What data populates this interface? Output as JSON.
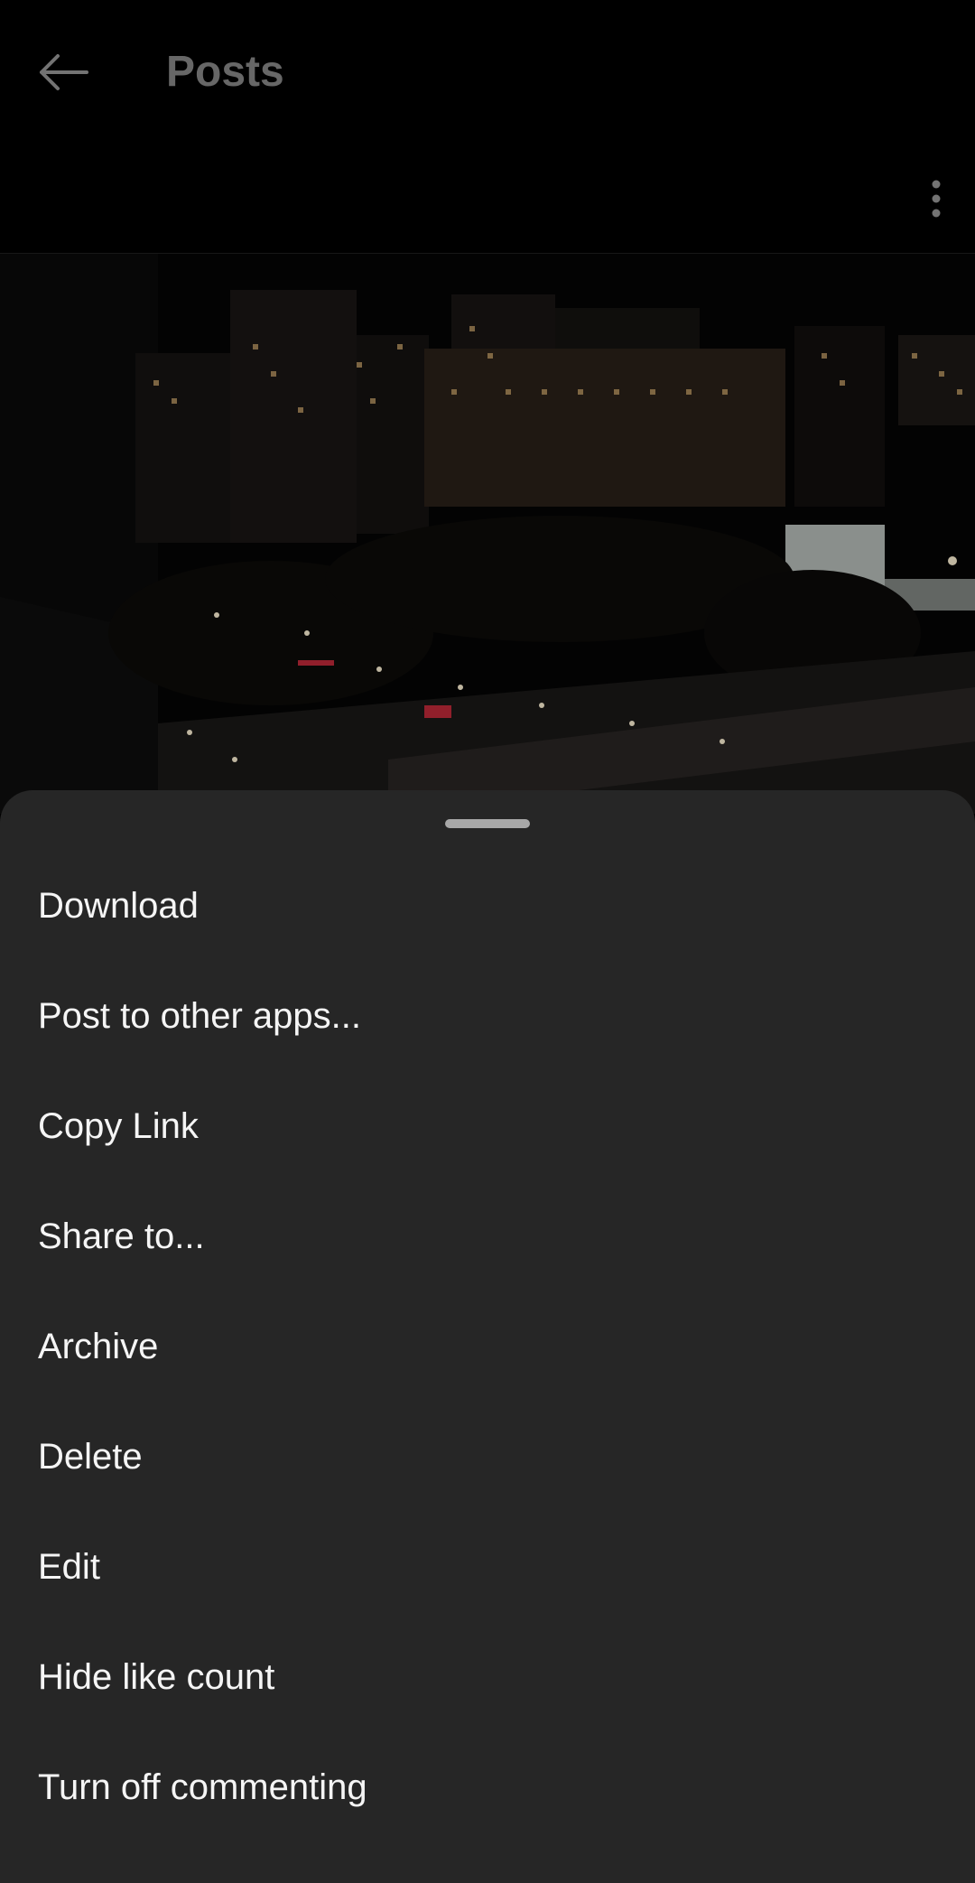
{
  "header": {
    "title": "Posts",
    "back_icon": "arrow-left-icon",
    "more_icon": "vertical-dots-icon"
  },
  "post": {
    "image_subject": "night city street"
  },
  "sheet": {
    "items": [
      {
        "label": "Download"
      },
      {
        "label": "Post to other apps..."
      },
      {
        "label": "Copy Link"
      },
      {
        "label": "Share to..."
      },
      {
        "label": "Archive"
      },
      {
        "label": "Delete"
      },
      {
        "label": "Edit"
      },
      {
        "label": "Hide like count"
      },
      {
        "label": "Turn off commenting"
      }
    ]
  },
  "colors": {
    "background": "#000000",
    "sheet": "#262626",
    "title": "#8a8a8a",
    "text": "#f5f5f5"
  }
}
